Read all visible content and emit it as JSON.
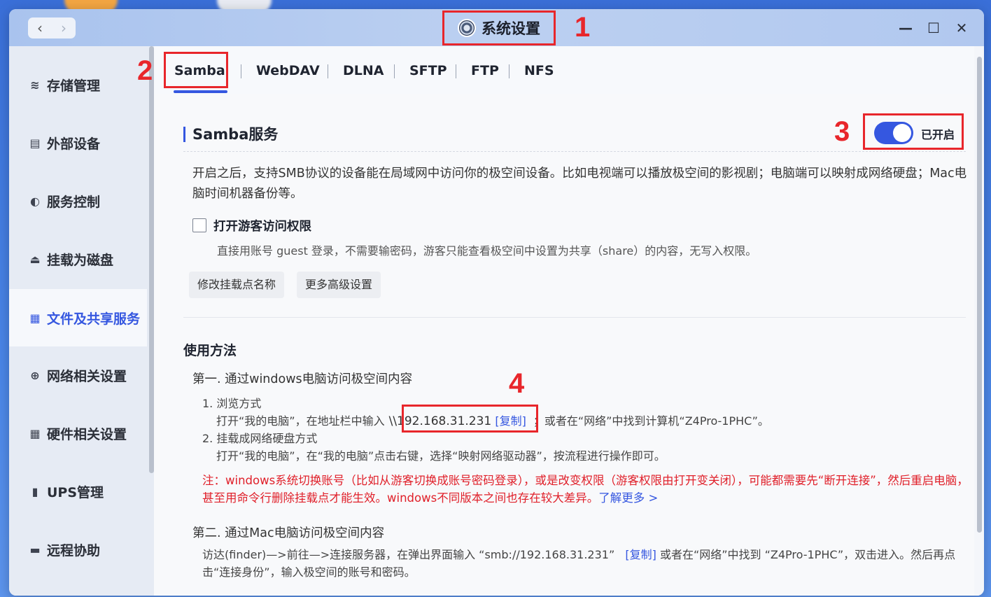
{
  "window": {
    "title": "系统设置",
    "nav_back": "‹",
    "nav_forward": "›",
    "min": "—",
    "max": "☐",
    "close": "✕"
  },
  "annotations": [
    "1",
    "2",
    "3",
    "4"
  ],
  "sidebar": {
    "items": [
      {
        "label": "存储管理",
        "icon": "database-icon"
      },
      {
        "label": "外部设备",
        "icon": "device-icon"
      },
      {
        "label": "服务控制",
        "icon": "toggle-icon"
      },
      {
        "label": "挂载为磁盘",
        "icon": "disk-icon"
      },
      {
        "label": "文件及共享服务",
        "icon": "file-share-icon",
        "active": true
      },
      {
        "label": "网络相关设置",
        "icon": "globe-icon"
      },
      {
        "label": "硬件相关设置",
        "icon": "grid-icon"
      },
      {
        "label": "UPS管理",
        "icon": "battery-icon"
      },
      {
        "label": "远程协助",
        "icon": "chat-icon"
      }
    ]
  },
  "tabs": [
    "Samba",
    "WebDAV",
    "DLNA",
    "SFTP",
    "FTP",
    "NFS"
  ],
  "samba": {
    "title": "Samba服务",
    "toggle_state": "已开启",
    "description": "开启之后，支持SMB协议的设备能在局域网中访问你的极空间设备。比如电视端可以播放极空间的影视剧；电脑端可以映射成网络硬盘；Mac电脑时间机器备份等。",
    "guest_label": "打开游客访问权限",
    "guest_hint": "直接用账号 guest 登录，不需要输密码，游客只能查看极空间中设置为共享（share）的内容，无写入权限。",
    "btn_rename": "修改挂载点名称",
    "btn_advanced": "更多高级设置"
  },
  "usage": {
    "heading": "使用方法",
    "win_title": "第一. 通过windows电脑访问极空间内容",
    "win_item1": "1. 浏览方式",
    "win_item1_pre": "打开“我的电脑”，在地址栏中输入",
    "win_ip": "\\\\192.168.31.231",
    "copy": "[复制]",
    "win_item1_post": "；或者在“网络”中找到计算机“Z4Pro-1PHC”。",
    "win_item2": "2. 挂载成网络硬盘方式",
    "win_item2_text": "打开“我的电脑”，在“我的电脑”点击右键，选择“映射网络驱动器”，按流程进行操作即可。",
    "warn_text": "注：windows系统切换账号（比如从游客切换成账号密码登录），或是改变权限（游客权限由打开变关闭），可能都需要先“断开连接”，然后重启电脑，甚至用命令行删除挂载点才能生效。windows不同版本之间也存在较大差异。",
    "learn_more": "了解更多 >",
    "mac_title": "第二. 通过Mac电脑访问极空间内容",
    "mac_pre": "访达(finder)—>前往—>连接服务器，在弹出界面输入 “smb://192.168.31.231”",
    "mac_copy": "[复制]",
    "mac_post": "或者在“网络”中找到 “Z4Pro-1PHC”，双击进入。然后再点击“连接身份”，输入极空间的账号和密码。"
  },
  "colors": {
    "accent": "#3557e0",
    "annotation": "#e8262b",
    "warning": "#e0202a"
  }
}
